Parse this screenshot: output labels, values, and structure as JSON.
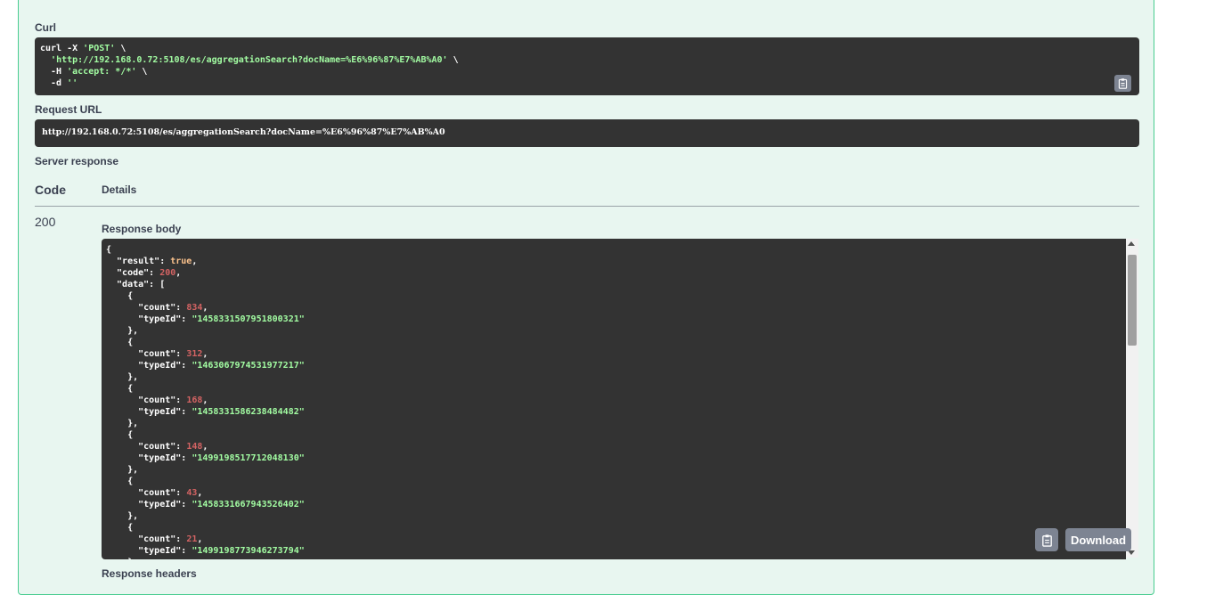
{
  "curl": {
    "label": "Curl",
    "line1_pre": "curl -X ",
    "line1_method": "'POST'",
    "line1_post": " \\",
    "line2_pre": "  ",
    "line2_url": "'http://192.168.0.72:5108/es/aggregationSearch?docName=%E6%96%87%E7%AB%A0'",
    "line2_post": " \\",
    "line3_pre": "  -H ",
    "line3_header": "'accept: */*'",
    "line3_post": " \\",
    "line4_pre": "  -d ",
    "line4_data": "''",
    "copy_icon": "clipboard-icon"
  },
  "request_url": {
    "label": "Request URL",
    "value": "http://192.168.0.72:5108/es/aggregationSearch?docName=%E6%96%87%E7%AB%A0"
  },
  "server_response": {
    "label": "Server response",
    "col_code": "Code",
    "col_details": "Details",
    "status_code": "200",
    "response_body_label": "Response body",
    "response_headers_label": "Response headers",
    "download_label": "Download",
    "copy_icon": "clipboard-icon"
  },
  "response_json": {
    "result": "true",
    "code": "200",
    "data": [
      {
        "count": "834",
        "typeId": "1458331507951800321"
      },
      {
        "count": "312",
        "typeId": "1463067974531977217"
      },
      {
        "count": "168",
        "typeId": "1458331586238484482"
      },
      {
        "count": "148",
        "typeId": "1499198517712048130"
      },
      {
        "count": "43",
        "typeId": "1458331667943526402"
      },
      {
        "count": "21",
        "typeId": "1499198773946273794"
      }
    ]
  },
  "colors": {
    "success_green": "#49cc90",
    "block_bg": "#e8f6f0",
    "code_bg": "#333333",
    "string": "#a2fca2",
    "number": "#d36363",
    "boolean": "#fcc28c"
  }
}
